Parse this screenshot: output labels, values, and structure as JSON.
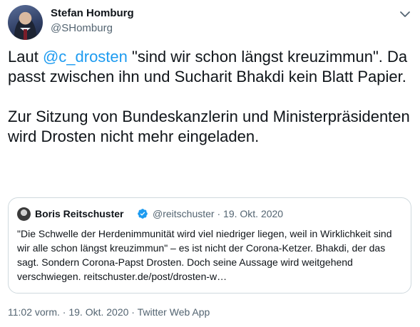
{
  "author": {
    "name": "Stefan Homburg",
    "handle": "@SHomburg"
  },
  "tweet": {
    "before_mention": "Laut ",
    "mention": "@c_drosten",
    "after_mention": " \"sind wir schon längst kreuzimmun\". Da passt zwischen ihn und Sucharit Bhakdi kein Blatt Papier.\n\nZur Sitzung von Bundeskanzlerin und Ministerpräsidenten wird Drosten nicht mehr eingeladen."
  },
  "quote": {
    "name": "Boris Reitschuster",
    "handle": "@reitschuster",
    "separator": "·",
    "date": "19. Okt. 2020",
    "text": "\"Die Schwelle der Herdenimmunität wird viel niedriger liegen, weil in Wirklichkeit sind wir alle schon längst kreuzimmun\" – es ist nicht der Corona-Ketzer. Bhakdi, der das sagt. Sondern Corona-Papst Drosten. Doch seine Aussage wird weitgehend verschwiegen. reitschuster.de/post/drosten-w…"
  },
  "footer": {
    "time": "11:02 vorm.",
    "sep1": "·",
    "date": "19. Okt. 2020",
    "sep2": "·",
    "source": "Twitter Web App"
  },
  "colors": {
    "accent": "#1d9bf0",
    "text": "#0f1419",
    "secondary": "#536471",
    "border": "#cfd9de"
  },
  "icons": {
    "menu": "chevron-down-icon",
    "verified": "verified-badge-icon"
  }
}
